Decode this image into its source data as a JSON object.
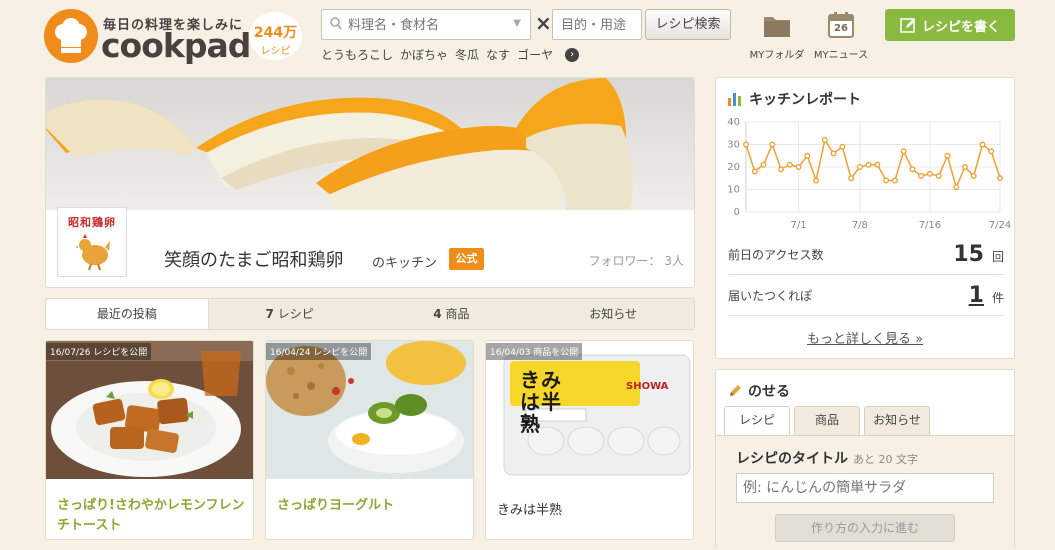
{
  "brand": {
    "tagline": "毎日の料理を楽しみに",
    "name": "cookpad",
    "recipe_count": "244万",
    "recipe_unit": "レシピ"
  },
  "search": {
    "keyword_placeholder": "料理名・食材名",
    "purpose_placeholder": "目的・用途",
    "button_label": "レシピ検索",
    "times_sign": "×",
    "suggestions": [
      "とうもろこし",
      "かぼちゃ",
      "冬瓜",
      "なす",
      "ゴーヤ"
    ]
  },
  "header_nav": {
    "folder_label": "MYフォルダ",
    "news_label": "MYニュース",
    "news_date": "26",
    "write_label": "レシピを書く"
  },
  "kitchen": {
    "logo_text": "昭和鶏卵",
    "name": "笑顔のたまご昭和鶏卵",
    "suffix": "のキッチン",
    "official_badge": "公式",
    "followers_label": "フォロワー：",
    "followers_count": "3人"
  },
  "tabs": [
    {
      "label": "最近の投稿",
      "count": ""
    },
    {
      "label": "レシピ",
      "count": "7"
    },
    {
      "label": "商品",
      "count": "4"
    },
    {
      "label": "お知らせ",
      "count": ""
    }
  ],
  "posts": [
    {
      "badge": "16/07/26 レシピを公開",
      "title": "さっぱり!さわやかレモンフレンチトースト"
    },
    {
      "badge": "16/04/24 レシピを公開",
      "title": "さっぱりヨーグルト"
    },
    {
      "badge": "16/04/03 商品を公開",
      "title": "きみは半熟",
      "product_text": "きみは半熟"
    }
  ],
  "report": {
    "title": "キッチンレポート",
    "chart_data": {
      "type": "line",
      "y_ticks": [
        0,
        10,
        20,
        30,
        40
      ],
      "ylim": [
        0,
        40
      ],
      "x_labels": [
        "7/1",
        "7/8",
        "7/16",
        "7/24"
      ],
      "values": [
        30,
        18,
        21,
        30,
        19,
        21,
        20,
        25,
        14,
        32,
        26,
        29,
        15,
        20,
        21,
        21,
        14,
        14,
        27,
        19,
        16,
        17,
        16,
        25,
        11,
        20,
        16,
        30,
        27,
        15
      ],
      "color": "#f0a030"
    },
    "access_label": "前日のアクセス数",
    "access_value": "15",
    "access_unit": "回",
    "tsukurepo_label": "届いたつくれぽ",
    "tsukurepo_value": "1",
    "tsukurepo_unit": "件",
    "more_label": "もっと詳しく見る »"
  },
  "post_form": {
    "title": "のせる",
    "tabs": [
      "レシピ",
      "商品",
      "お知らせ"
    ],
    "field_label": "レシピのタイトル",
    "remaining": "あと 20 文字",
    "placeholder": "例: にんじんの簡単サラダ",
    "next_label": "作り方の入力に進む"
  },
  "colors": {
    "brand_orange": "#f08c1a",
    "accent_green": "#8ab93f",
    "background": "#f6f1e4"
  }
}
